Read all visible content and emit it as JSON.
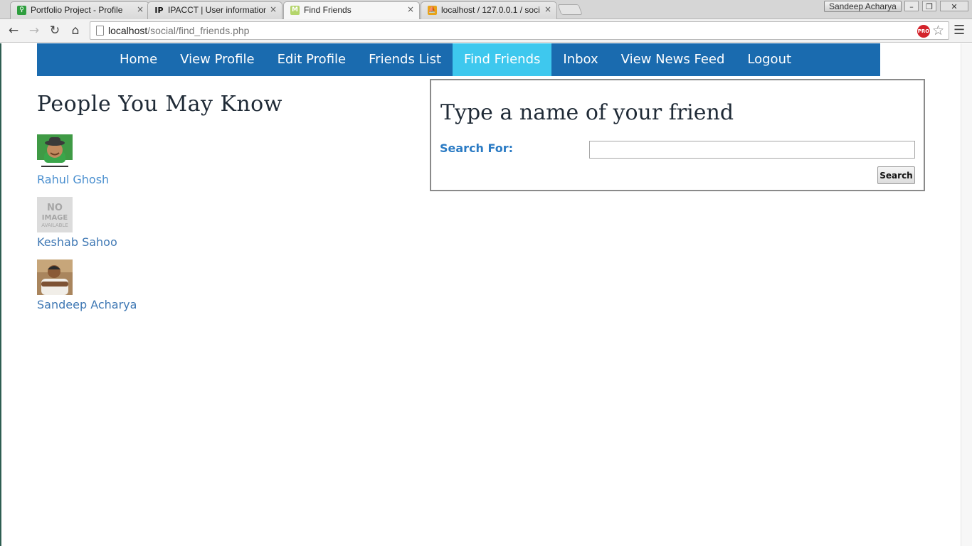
{
  "browser": {
    "tabs": [
      {
        "title": "Portfolio Project - Profile",
        "close": "×",
        "favicon": "portfolio-favicon",
        "color": "#2e9e3e"
      },
      {
        "title": "IPACCT | User information",
        "close": "×",
        "favicon": "ipacct-favicon",
        "color": "#111111"
      },
      {
        "title": "Find Friends",
        "close": "×",
        "favicon": "m-favicon",
        "color": "#b4d56a"
      },
      {
        "title": "localhost / 127.0.0.1 / soci",
        "close": "×",
        "favicon": "phpmyadmin-favicon",
        "color": "#e8a318"
      }
    ],
    "profile_name": "Sandeep Acharya",
    "url_host": "localhost",
    "url_path": "/social/find_friends.php",
    "extension_badge": "PRO"
  },
  "nav": {
    "items": [
      "Home",
      "View Profile",
      "Edit Profile",
      "Friends List",
      "Find Friends",
      "Inbox",
      "View News Feed",
      "Logout"
    ],
    "active": "Find Friends",
    "bar_color": "#1a6baf",
    "active_color": "#3ec8ee"
  },
  "suggestions": {
    "title": "People You May Know",
    "people": [
      {
        "name": "Rahul Ghosh"
      },
      {
        "name": "Keshab Sahoo"
      },
      {
        "name": "Sandeep Acharya"
      }
    ]
  },
  "search": {
    "title": "Type a name of your friend",
    "label": "Search For:",
    "value": "",
    "button": "Search"
  }
}
